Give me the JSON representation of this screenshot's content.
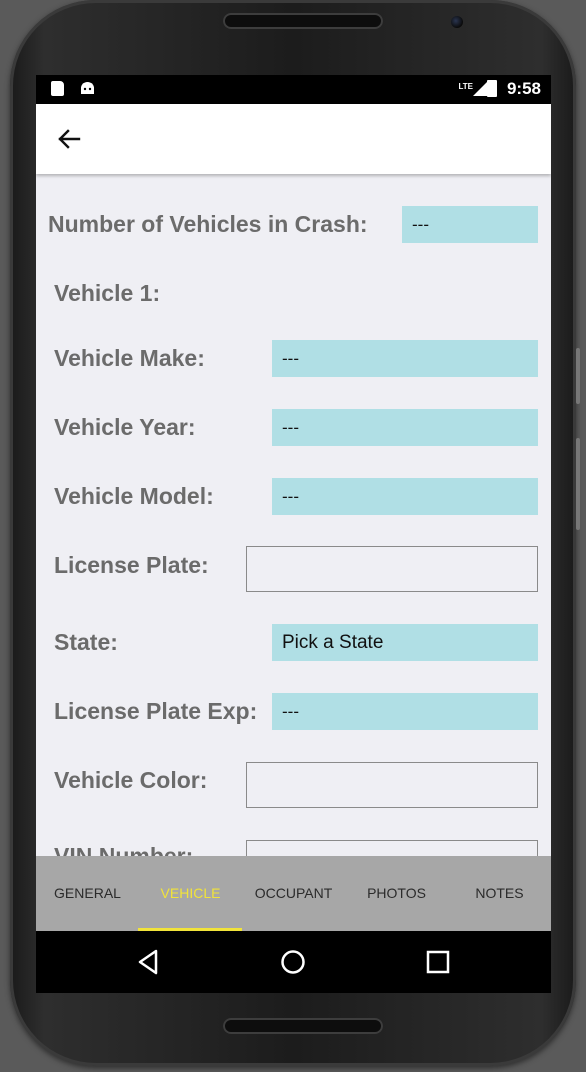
{
  "status_bar": {
    "network_label": "LTE",
    "time": "9:58"
  },
  "toolbar": {
    "back_icon": "arrow-left-icon"
  },
  "form": {
    "num_vehicles": {
      "label": "Number of Vehicles in Crash:",
      "value": "---"
    },
    "vehicle_heading": "Vehicle 1:",
    "make": {
      "label": "Vehicle Make:",
      "value": "---"
    },
    "year": {
      "label": "Vehicle Year:",
      "value": "---"
    },
    "model": {
      "label": "Vehicle Model:",
      "value": "---"
    },
    "plate": {
      "label": "License Plate:",
      "value": ""
    },
    "state": {
      "label": "State:",
      "value": "Pick a State"
    },
    "plate_exp": {
      "label": "License Plate Exp:",
      "value": "---"
    },
    "color": {
      "label": "Vehicle Color:",
      "value": ""
    },
    "vin": {
      "label": "VIN Number:",
      "value": ""
    }
  },
  "tabs": [
    {
      "label": "GENERAL",
      "active": false
    },
    {
      "label": "VEHICLE",
      "active": true
    },
    {
      "label": "OCCUPANT",
      "active": false
    },
    {
      "label": "PHOTOS",
      "active": false
    },
    {
      "label": "NOTES",
      "active": false
    }
  ],
  "nav_bar": {
    "back": "triangle-back-icon",
    "home": "circle-home-icon",
    "recents": "square-recents-icon"
  },
  "colors": {
    "field_fill": "#b0dfe5",
    "tab_active": "#f1e33a",
    "tab_bar": "#a7a7a7",
    "label_text": "#6b6b6b"
  }
}
